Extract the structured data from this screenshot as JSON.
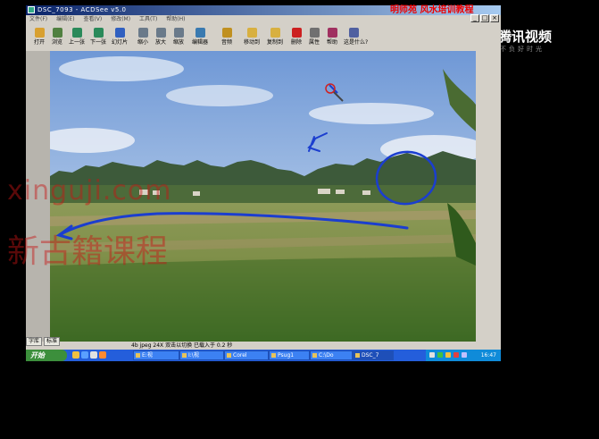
{
  "window": {
    "title": "DSC_7093 - ACDSee v5.0",
    "brand_overlay": "明师苑 风水培训教程",
    "controls": [
      "_",
      "□",
      "×"
    ]
  },
  "menu": [
    "文件(F)",
    "编辑(E)",
    "查看(V)",
    "修改(M)",
    "工具(T)",
    "帮助(H)"
  ],
  "toolbar": [
    {
      "label": "打开",
      "icon": "open-folder-icon",
      "color": "#d8a030"
    },
    {
      "label": "浏览",
      "icon": "browse-icon",
      "color": "#508040"
    },
    {
      "label": "上一张",
      "icon": "prev-icon",
      "color": "#2a8a5a"
    },
    {
      "label": "下一张",
      "icon": "next-icon",
      "color": "#2a8a5a"
    },
    {
      "label": "幻灯片",
      "icon": "slideshow-icon",
      "color": "#3060c0"
    },
    {
      "label": "缩小",
      "icon": "zoom-out-icon",
      "color": "#6a7a8a"
    },
    {
      "label": "放大",
      "icon": "zoom-in-icon",
      "color": "#6a7a8a"
    },
    {
      "label": "缩放",
      "icon": "zoom-icon",
      "color": "#6a7a8a"
    },
    {
      "label": "编辑器",
      "icon": "editor-icon",
      "color": "#3a7ab0"
    },
    {
      "label": "音频",
      "icon": "audio-icon",
      "color": "#c09020"
    },
    {
      "label": "移动到",
      "icon": "move-to-icon",
      "color": "#d8b040"
    },
    {
      "label": "复制到",
      "icon": "copy-to-icon",
      "color": "#d8b040"
    },
    {
      "label": "删除",
      "icon": "delete-icon",
      "color": "#cc2020"
    },
    {
      "label": "属性",
      "icon": "properties-icon",
      "color": "#707070"
    },
    {
      "label": "帮助",
      "icon": "help-icon",
      "color": "#a03060"
    },
    {
      "label": "这是什么?",
      "icon": "whats-this-icon",
      "color": "#5060a0"
    }
  ],
  "ime_bar": [
    "字库",
    "标准"
  ],
  "status": "4b jpeg  24X  双击以切换  已载入于 0.2 秒",
  "taskbar": {
    "start_label": "开始",
    "tasks": [
      "E:视",
      "I:\\视",
      "Corel",
      "Psug1",
      "C:\\Do",
      "DSC_7"
    ],
    "clock": "16:47"
  },
  "tencent": {
    "name": "腾讯视频",
    "slogan": "不负好时光"
  },
  "watermark": {
    "latin": "xinguji.com",
    "chinese": "新古籍课程"
  }
}
